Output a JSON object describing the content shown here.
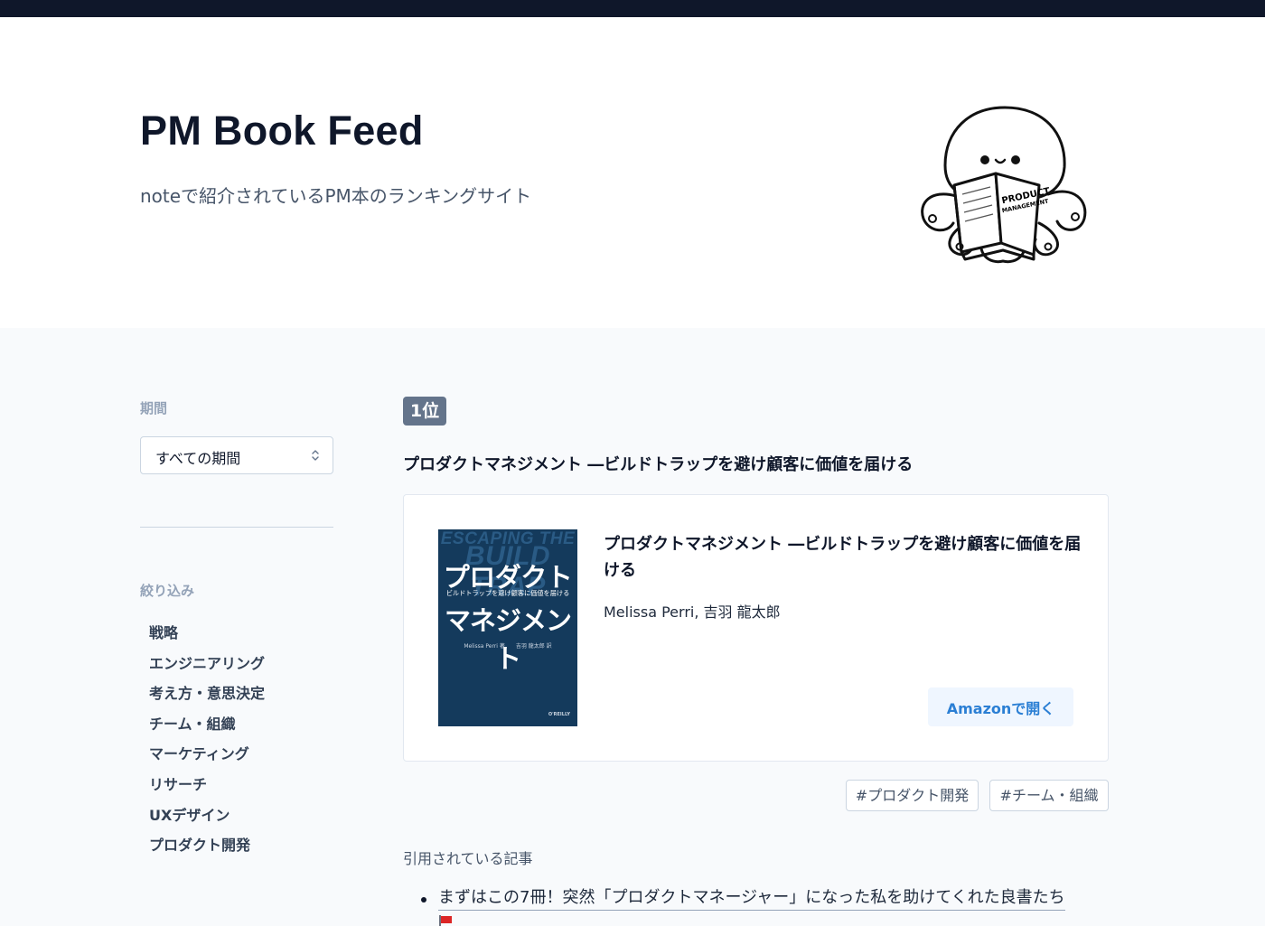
{
  "header": {
    "title": "PM Book Feed",
    "subtitle": "noteで紹介されているPM本のランキングサイト"
  },
  "mascot": {
    "icon": "octopus-reading-icon",
    "book_label_1": "PRODUCT",
    "book_label_2": "MANAGEMENT"
  },
  "sidebar": {
    "period_label": "期間",
    "period_selected": "すべての期間",
    "filter_label": "絞り込み",
    "filters": [
      "戦略",
      "エンジニアリング",
      "考え方・意思決定",
      "チーム・組織",
      "マーケティング",
      "リサーチ",
      "UXデザイン",
      "プロダクト開発"
    ]
  },
  "ranking": {
    "rank_label": "1位",
    "heading": "プロダクトマネジメント ―ビルドトラップを避け顧客に価値を届ける",
    "card": {
      "title": "プロダクトマネジメント ―ビルドトラップを避け顧客に価値を届ける",
      "author": "Melissa Perri, 吉羽 龍太郎",
      "button_label": "Amazonで開く",
      "cover": {
        "en_line1": "ESCAPING THE",
        "en_line2": "BUILD TRAP",
        "jp_line1": "プロダクト",
        "jp_sub": "ビルドトラップを避け顧客に価値を届ける",
        "jp_line2": "マネジメント",
        "authors": "Melissa Perri 著　　吉羽 龍太郎 訳",
        "publisher": "O'REILLY"
      }
    },
    "tags": [
      "#プロダクト開発",
      "#チーム・組織"
    ]
  },
  "articles": {
    "label": "引用されている記事",
    "items": [
      "まずはこの7冊！突然「プロダクトマネージャー」になった私を助けてくれた良書たち"
    ]
  },
  "colors": {
    "topbar": "#0f172a",
    "badge": "#64748b",
    "button_bg": "#eff6ff",
    "button_text": "#2b7fd4"
  }
}
